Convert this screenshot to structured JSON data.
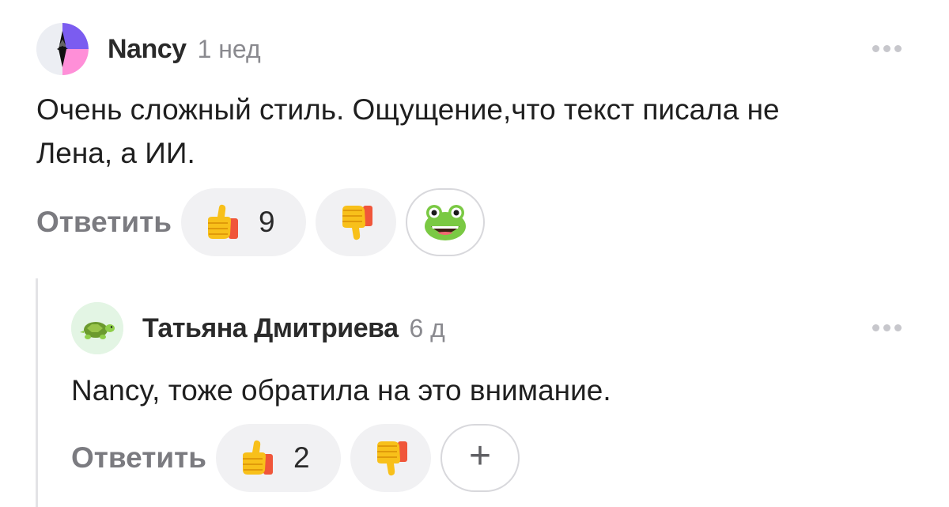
{
  "comments": [
    {
      "author": "Nancy",
      "time": "1 нед",
      "text_line1": "Очень сложный стиль. Ощущение,что текст писала не",
      "text_line2": "Лена, а ИИ.",
      "reply_label": "Ответить",
      "likes": "9",
      "reaction_icon": "frog-emoji-icon"
    },
    {
      "author": "Татьяна Дмитриева",
      "time": "6 д",
      "text": "Nancy, тоже обратила на это внимание.",
      "reply_label": "Ответить",
      "likes": "2",
      "add_reaction": "+"
    }
  ],
  "colors": {
    "pill_bg": "#f1f1f3",
    "muted_text": "#8a8a8f",
    "avatar2_bg": "#e3f5e4"
  }
}
